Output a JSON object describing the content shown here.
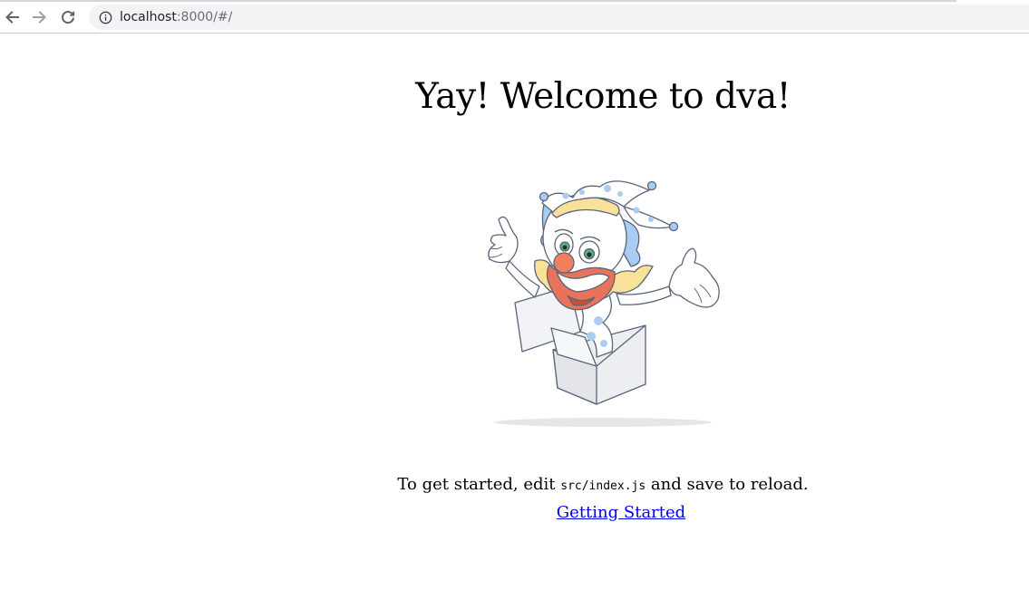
{
  "browser": {
    "url_host": "localhost",
    "url_rest": ":8000/#/",
    "icons": {
      "back": "arrow-left-icon",
      "forward": "arrow-right-icon",
      "reload": "reload-icon",
      "info": "info-icon"
    }
  },
  "page": {
    "title": "Yay! Welcome to dva!",
    "hint_before": "To get started, edit ",
    "hint_code": "src/index.js",
    "hint_after": " and save to reload.",
    "link_label": "Getting Started"
  },
  "colors": {
    "link": "#0000ee",
    "clown_blue": "#a9cdf2",
    "clown_nose": "#f07f5e",
    "collar": "#f8e29a"
  }
}
